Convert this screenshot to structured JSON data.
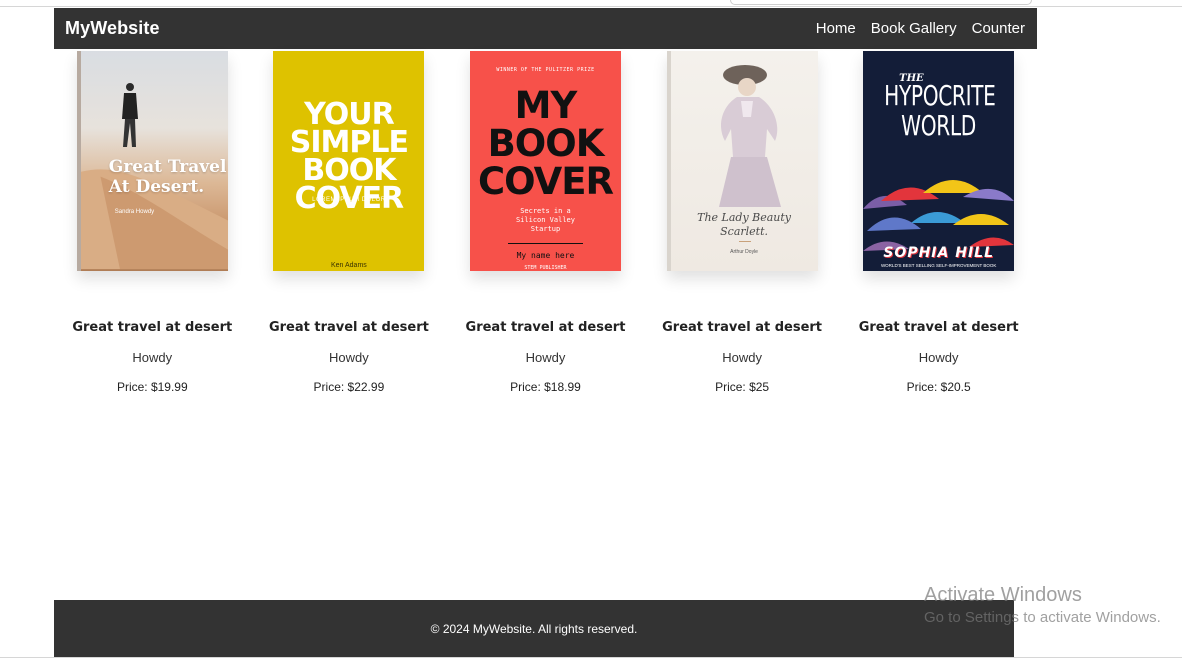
{
  "navbar": {
    "brand": "MyWebsite",
    "links": [
      "Home",
      "Book Gallery",
      "Counter"
    ]
  },
  "books": [
    {
      "title": "Great travel at desert",
      "author": "Howdy",
      "price": "Price: $19.99",
      "cover": {
        "title_line1": "Great Travel",
        "title_line2": "At Desert.",
        "author": "Sandra Howdy"
      }
    },
    {
      "title": "Great travel at desert",
      "author": "Howdy",
      "price": "Price: $22.99",
      "cover": {
        "title_line1": "YOUR",
        "title_line2": "SIMPLE",
        "title_line3": "BOOK",
        "title_line4": "COVER",
        "subtitle": "LOREM IPSUM DOLOR",
        "author": "Ken Adams"
      }
    },
    {
      "title": "Great travel at desert",
      "author": "Howdy",
      "price": "Price: $18.99",
      "cover": {
        "top": "WINNER OF THE PULITZER PRIZE",
        "title_line1": "MY",
        "title_line2": "BOOK",
        "title_line3": "COVER",
        "sub_line1": "Secrets in a",
        "sub_line2": "Silicon Valley",
        "sub_line3": "Startup",
        "name": "My name here",
        "publisher": "STEM PUBLISHER"
      }
    },
    {
      "title": "Great travel at desert",
      "author": "Howdy",
      "price": "Price: $25",
      "cover": {
        "title_line1": "The Lady Beauty",
        "title_line2": "Scarlett.",
        "author": "Arthur Doyle"
      }
    },
    {
      "title": "Great travel at desert",
      "author": "Howdy",
      "price": "Price: $20.5",
      "cover": {
        "the": "THE",
        "title_line1": "HYPOCRITE",
        "title_line2": "WORLD",
        "author": "SOPHIA HILL",
        "tagline": "WORLD'S BEST SELLING SELF-IMPROVEMENT BOOK"
      }
    }
  ],
  "footer": {
    "text": "© 2024 MyWebsite. All rights reserved."
  },
  "watermark": {
    "title": "Activate Windows",
    "subtitle": "Go to Settings to activate Windows."
  },
  "colors": {
    "navbar": "#333333",
    "footer": "#333333",
    "cover_yellow": "#dec200",
    "cover_red": "#f7514a",
    "cover_navy": "#131d38"
  }
}
